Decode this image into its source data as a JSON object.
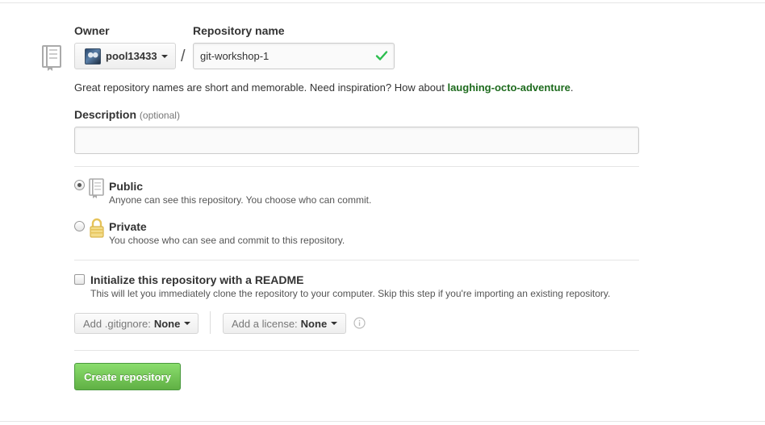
{
  "form": {
    "owner_label": "Owner",
    "owner_value": "pool13433",
    "separator": "/",
    "repo_name_label": "Repository name",
    "repo_name_value": "git-workshop-1",
    "hint_text": "Great repository names are short and memorable. Need inspiration? How about ",
    "hint_suggestion": "laughing-octo-adventure",
    "hint_end": ".",
    "description_label": "Description",
    "description_optional": "(optional)",
    "description_value": "",
    "visibility": {
      "selected": "public",
      "public_title": "Public",
      "public_desc": "Anyone can see this repository. You choose who can commit.",
      "private_title": "Private",
      "private_desc": "You choose who can see and commit to this repository."
    },
    "readme": {
      "checked": false,
      "title": "Initialize this repository with a README",
      "desc": "This will let you immediately clone the repository to your computer. Skip this step if you're importing an existing repository."
    },
    "gitignore": {
      "label": "Add .gitignore:",
      "value": "None"
    },
    "license": {
      "label": "Add a license:",
      "value": "None"
    },
    "submit_label": "Create repository"
  },
  "icons": {
    "repo": "repo-icon",
    "check": "check-icon",
    "lock": "lock-icon",
    "info": "info-icon"
  },
  "colors": {
    "accent_green": "#60b044",
    "success_check": "#2cbe4e",
    "suggestion_text": "#1e6b1e",
    "lock_gold": "#e6c35a"
  }
}
